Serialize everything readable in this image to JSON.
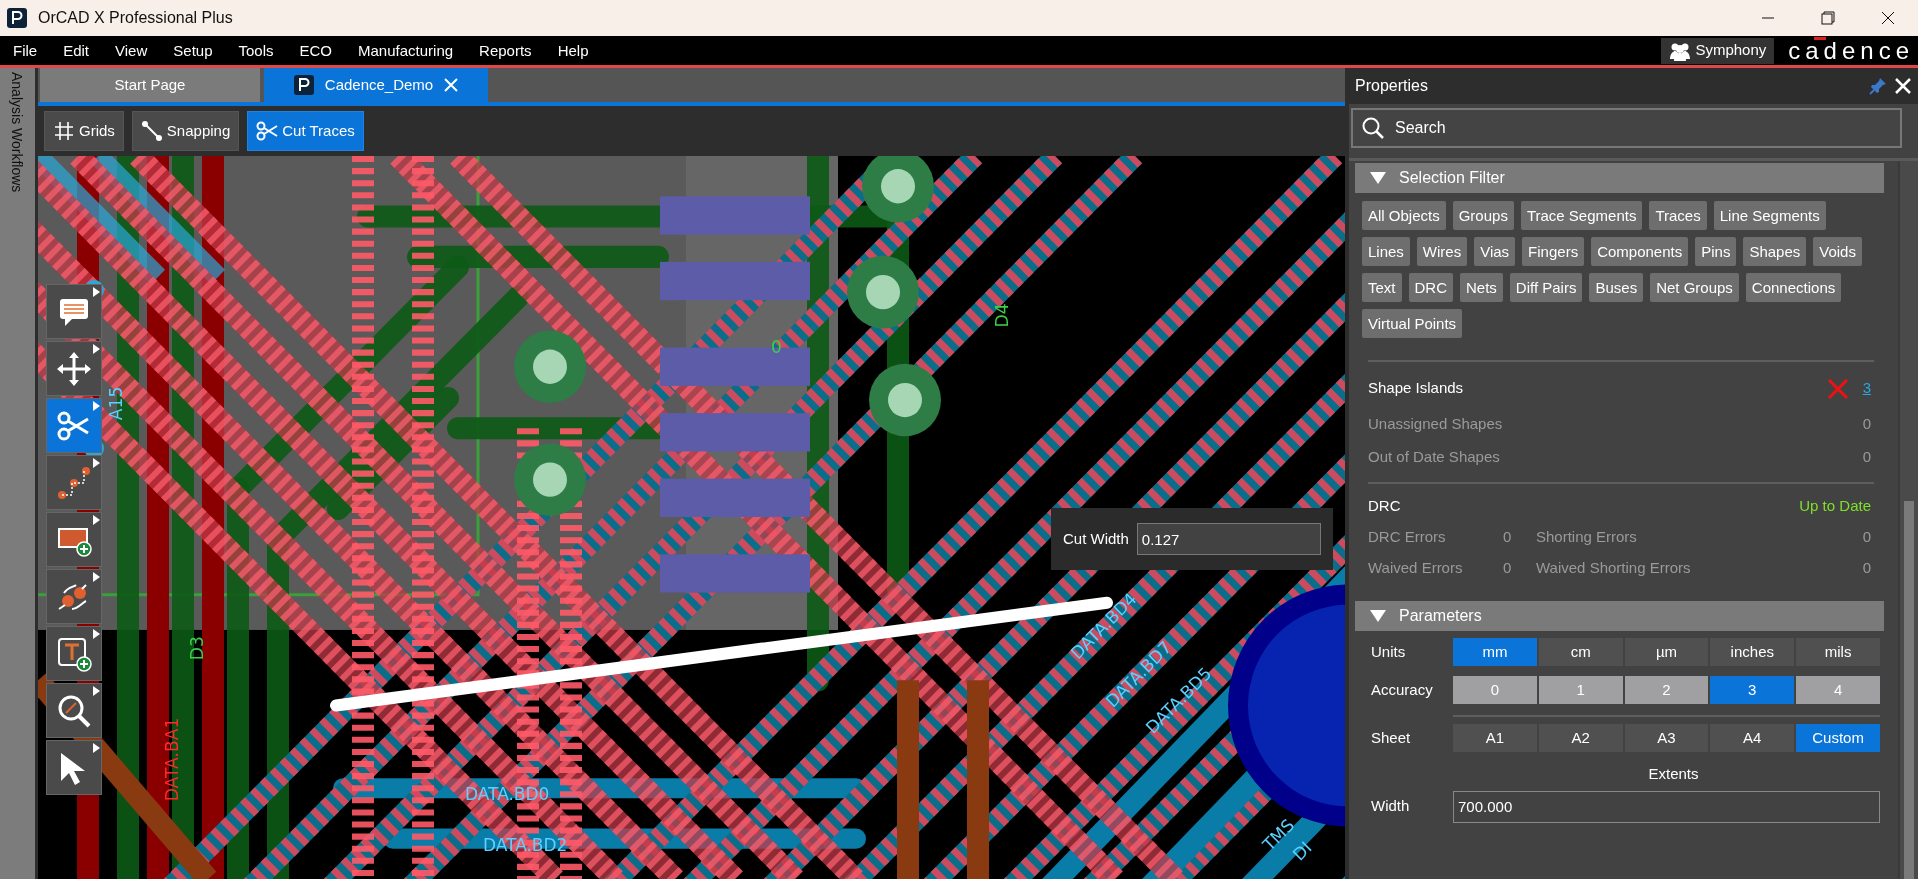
{
  "window": {
    "title": "OrCAD X Professional Plus"
  },
  "menu": [
    "File",
    "Edit",
    "View",
    "Setup",
    "Tools",
    "ECO",
    "Manufacturing",
    "Reports",
    "Help"
  ],
  "symphony": {
    "label": "Symphony"
  },
  "logo": {
    "text": "cadence"
  },
  "side_strip": {
    "label": "Analysis Workflows"
  },
  "tabs": [
    {
      "label": "Start Page",
      "selected": false,
      "closable": false
    },
    {
      "label": "Cadence_Demo",
      "selected": true,
      "closable": true
    }
  ],
  "toolbar": [
    {
      "label": "Grids",
      "kind": "grid",
      "selected": false
    },
    {
      "label": "Snapping",
      "kind": "snap",
      "selected": false
    },
    {
      "label": "Cut Traces",
      "kind": "cut",
      "selected": true
    }
  ],
  "tool_palette": [
    {
      "kind": "comment",
      "selected": false
    },
    {
      "kind": "move",
      "selected": false
    },
    {
      "kind": "cut",
      "selected": true
    },
    {
      "kind": "route",
      "selected": false
    },
    {
      "kind": "shape",
      "selected": false
    },
    {
      "kind": "connect",
      "selected": false
    },
    {
      "kind": "text",
      "selected": false
    },
    {
      "kind": "zoom",
      "selected": false
    },
    {
      "kind": "select",
      "selected": false
    }
  ],
  "canvas": {
    "labels": [
      {
        "text": "DATA.BA1",
        "kind": "red"
      },
      {
        "text": "A15",
        "kind": "blue"
      },
      {
        "text": "D3",
        "kind": "green"
      },
      {
        "text": "0",
        "kind": "green"
      },
      {
        "text": "D4",
        "kind": "green"
      },
      {
        "text": "DATA.BD0",
        "kind": "blue"
      },
      {
        "text": "DATA.BD2",
        "kind": "blue"
      },
      {
        "text": "DATA.BD4",
        "kind": "blue"
      },
      {
        "text": "DATA.BD7",
        "kind": "blue"
      },
      {
        "text": "DATA.BD5",
        "kind": "blue"
      },
      {
        "text": "TMS",
        "kind": "blue"
      },
      {
        "text": "DI",
        "kind": "blue"
      }
    ],
    "cut_width": {
      "label": "Cut Width",
      "value": "0.127"
    }
  },
  "properties": {
    "title": "Properties",
    "search": {
      "placeholder": "Search"
    },
    "selection_filter": {
      "title": "Selection Filter",
      "expanded": true,
      "chips": [
        "All Objects",
        "Groups",
        "Trace Segments",
        "Traces",
        "Line Segments",
        "Lines",
        "Wires",
        "Vias",
        "Fingers",
        "Components",
        "Pins",
        "Shapes",
        "Voids",
        "Text",
        "DRC",
        "Nets",
        "Diff Pairs",
        "Buses",
        "Net Groups",
        "Connections",
        "Virtual Points"
      ]
    },
    "shapes": {
      "title": "Shape Islands",
      "error": true,
      "count": "3",
      "rows": [
        {
          "label": "Unassigned Shapes",
          "value": "0"
        },
        {
          "label": "Out of Date Shapes",
          "value": "0"
        }
      ]
    },
    "drc": {
      "title": "DRC",
      "status": "Up to Date",
      "cells": [
        {
          "label": "DRC Errors",
          "value": "0"
        },
        {
          "label": "Shorting Errors",
          "value": "0"
        },
        {
          "label": "Waived Errors",
          "value": "0"
        },
        {
          "label": "Waived Shorting Errors",
          "value": "0"
        }
      ]
    },
    "parameters": {
      "title": "Parameters",
      "expanded": true,
      "groups": [
        {
          "label": "Units",
          "kind": "dark",
          "options": [
            {
              "label": "mm",
              "selected": true
            },
            {
              "label": "cm",
              "selected": false
            },
            {
              "label": "µm",
              "selected": false
            },
            {
              "label": "inches",
              "selected": false
            },
            {
              "label": "mils",
              "selected": false
            }
          ]
        },
        {
          "label": "Accuracy",
          "kind": "light",
          "options": [
            {
              "label": "0",
              "selected": false
            },
            {
              "label": "1",
              "selected": false
            },
            {
              "label": "2",
              "selected": false
            },
            {
              "label": "3",
              "selected": true
            },
            {
              "label": "4",
              "selected": false
            }
          ]
        },
        {
          "label": "Sheet",
          "kind": "dark",
          "options": [
            {
              "label": "A1",
              "selected": false
            },
            {
              "label": "A2",
              "selected": false
            },
            {
              "label": "A3",
              "selected": false
            },
            {
              "label": "A4",
              "selected": false
            },
            {
              "label": "Custom",
              "selected": true
            }
          ]
        }
      ],
      "extents": "Extents",
      "width": {
        "label": "Width",
        "value": "700.000"
      }
    }
  }
}
